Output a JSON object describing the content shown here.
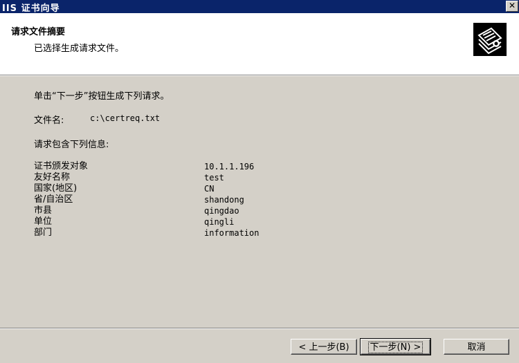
{
  "window": {
    "title": "IIS 证书向导",
    "close_label": "✕"
  },
  "header": {
    "title": "请求文件摘要",
    "subtitle": "已选择生成请求文件。",
    "icon": "certificate-icon"
  },
  "content": {
    "instruction": "单击“下一步”按钮生成下列请求。",
    "file_label": "文件名:",
    "file_value": "c:\\certreq.txt",
    "info_heading": "请求包含下列信息:",
    "rows": [
      {
        "label": "证书颁发对象",
        "value": "10.1.1.196"
      },
      {
        "label": "友好名称",
        "value": "test"
      },
      {
        "label": "国家(地区)",
        "value": "CN"
      },
      {
        "label": "省/自治区",
        "value": "shandong"
      },
      {
        "label": "市县",
        "value": "qingdao"
      },
      {
        "label": "单位",
        "value": "qingli"
      },
      {
        "label": "部门",
        "value": "information"
      }
    ]
  },
  "buttons": {
    "back": "< 上一步(B)",
    "next": "下一步(N) >",
    "cancel": "取消"
  }
}
